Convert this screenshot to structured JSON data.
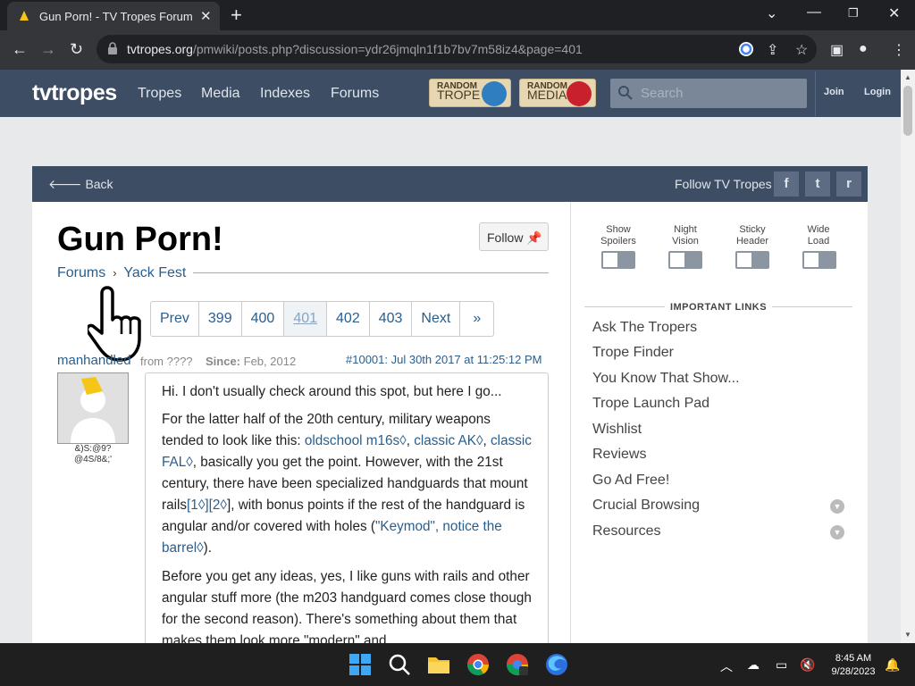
{
  "browser": {
    "tab_title": "Gun Porn! - TV Tropes Forum",
    "url_domain": "tvtropes.org",
    "url_path": "/pmwiki/posts.php?discussion=ydr26jmqln1f1b7bv7m58iz4&page=401"
  },
  "site": {
    "logo": "tvtropes",
    "nav": [
      "Tropes",
      "Media",
      "Indexes",
      "Forums"
    ],
    "random_trope": {
      "top": "RANDOM",
      "bottom": "TROPE"
    },
    "random_media": {
      "top": "RANDOM",
      "bottom": "MEDIA"
    },
    "search_placeholder": "Search",
    "join": "Join",
    "login": "Login"
  },
  "card_header": {
    "back": "Back",
    "follow_tv_tropes": "Follow TV Tropes",
    "social": [
      "f",
      "t",
      "r"
    ]
  },
  "thread": {
    "title": "Gun Porn!",
    "follow": "Follow",
    "breadcrumb": [
      "Forums",
      "Yack Fest"
    ],
    "pager": [
      "Prev",
      "399",
      "400",
      "401",
      "402",
      "403",
      "Next",
      "»"
    ],
    "current_page": "401"
  },
  "post": {
    "username": "manhandled",
    "from": "from ????",
    "since_label": "Since:",
    "since": "Feb, 2012",
    "post_id": "#10001: Jul 30th 2017 at 11:25:12 PM",
    "signature": "&)S:@9? @4S/8&;'",
    "p1": "Hi. I don't usually check around this spot, but here I go...",
    "p2_a": "For the latter half of the 20th century, military weapons tended to look like this: ",
    "link_m16": "oldschool m16s",
    "p2_comma1": ", ",
    "link_ak": "classic AK",
    "p2_comma2": ", ",
    "link_fal": "classic FAL",
    "p2_b": ", basically you get the point. However, with the 21st century, there have been specialized handguards that mount rails",
    "link_1": "[1",
    "link_2": "][2",
    "p2_c": "], with bonus points if the rest of the handguard is angular and/or covered with holes (",
    "link_keymod": "\"Keymod\", notice the barrel",
    "p2_d": ").",
    "p3": "Before you get any ideas, yes, I like guns with rails and other angular stuff more (the m203 handguard comes close though for the second reason). There's something about them that makes them look more \"modern\" and",
    "ext_mark": "◊"
  },
  "sidebar": {
    "toggles": [
      {
        "line1": "Show",
        "line2": "Spoilers"
      },
      {
        "line1": "Night",
        "line2": "Vision"
      },
      {
        "line1": "Sticky",
        "line2": "Header"
      },
      {
        "line1": "Wide",
        "line2": "Load"
      }
    ],
    "important_links_heading": "IMPORTANT LINKS",
    "links": [
      "Ask The Tropers",
      "Trope Finder",
      "You Know That Show...",
      "Trope Launch Pad",
      "Wishlist",
      "Reviews",
      "Go Ad Free!",
      "Crucial Browsing",
      "Resources"
    ]
  },
  "taskbar": {
    "time": "8:45 AM",
    "date": "9/28/2023"
  },
  "colors": {
    "site_header": "#3d4d64",
    "link": "#2a5e8d",
    "page_bg": "#e8e9eb"
  }
}
